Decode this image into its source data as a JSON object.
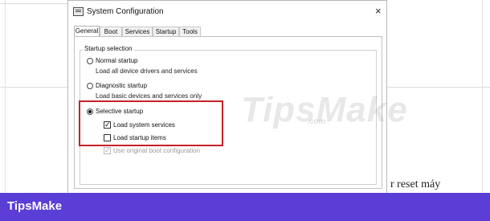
{
  "window": {
    "title": "System Configuration",
    "close_icon": "×"
  },
  "tabs": [
    {
      "label": "General",
      "active": true
    },
    {
      "label": "Boot",
      "active": false
    },
    {
      "label": "Services",
      "active": false
    },
    {
      "label": "Startup",
      "active": false
    },
    {
      "label": "Tools",
      "active": false
    }
  ],
  "startup_selection": {
    "group_label": "Startup selection",
    "normal": {
      "label": "Normal startup",
      "description": "Load all device drivers and services",
      "selected": false
    },
    "diagnostic": {
      "label": "Diagnostic startup",
      "description": "Load basic devices and services only",
      "selected": false
    },
    "selective": {
      "label": "Selective startup",
      "selected": true,
      "options": [
        {
          "label": "Load system services",
          "checked": true,
          "enabled": true
        },
        {
          "label": "Load startup items",
          "checked": false,
          "enabled": true
        },
        {
          "label": "Use original boot configuration",
          "checked": true,
          "enabled": false
        }
      ]
    }
  },
  "background": {
    "partial_text": "r reset máy"
  },
  "watermark": {
    "text": "TipsMake",
    "suffix": ".com"
  },
  "footer": {
    "brand": "TipsMake",
    "color": "#5a3ed6"
  },
  "highlight_color": "#c8202a",
  "icons": {
    "app": "msconfig-window-icon",
    "close": "close-icon"
  }
}
